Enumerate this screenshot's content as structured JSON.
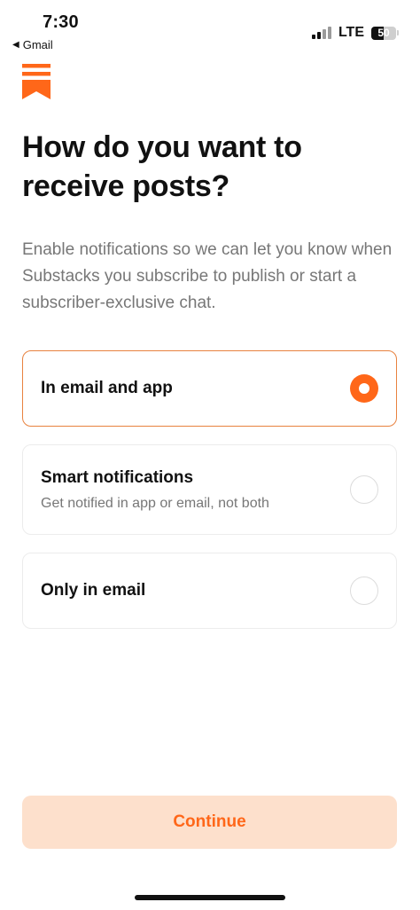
{
  "status_bar": {
    "time": "7:30",
    "back_app": "Gmail",
    "back_arrow": "◀",
    "network": "LTE",
    "battery": "50",
    "battery_level": 0.5
  },
  "logo": {
    "icon": "substack-logo",
    "color": "#ff6719"
  },
  "page": {
    "title": "How do you want to receive posts?",
    "subtitle": "Enable notifications so we can let you know when Substacks you subscribe to publish or start a subscriber-exclusive chat."
  },
  "options": [
    {
      "title": "In email and app",
      "description": "",
      "selected": true
    },
    {
      "title": "Smart notifications",
      "description": "Get notified in app or email, not both",
      "selected": false
    },
    {
      "title": "Only in email",
      "description": "",
      "selected": false
    }
  ],
  "actions": {
    "continue_label": "Continue"
  },
  "colors": {
    "accent": "#ff6719",
    "selected_border": "#e8823f",
    "continue_bg": "#fde0cc"
  }
}
